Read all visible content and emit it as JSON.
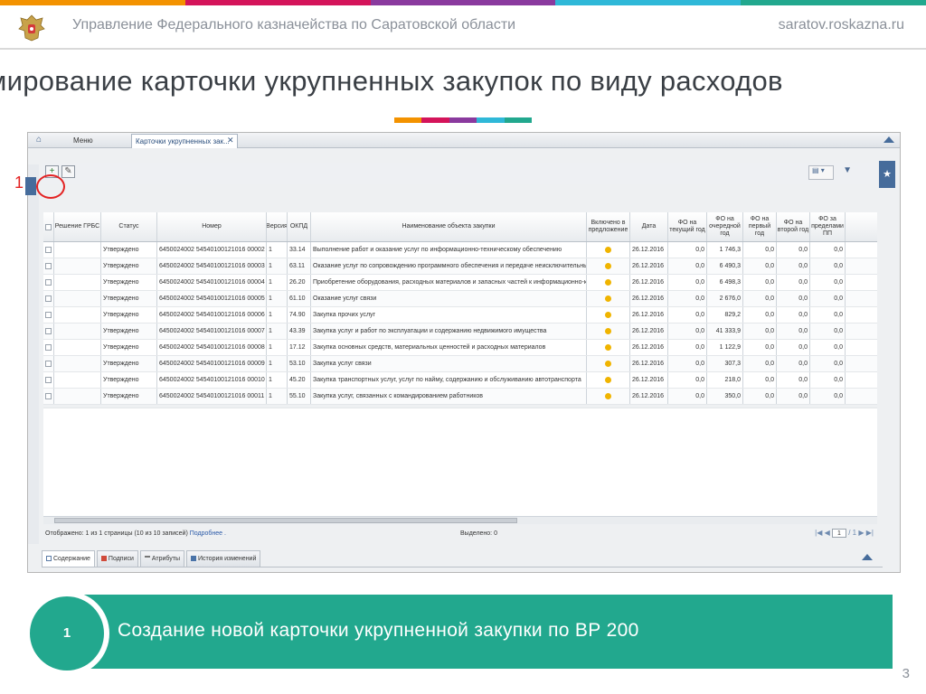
{
  "colors": {
    "orange": "#f39200",
    "magenta": "#d4145a",
    "purple": "#8a3a9e",
    "cyan": "#2fb8d8",
    "teal": "#22a88e",
    "annotation_red": "#e32222",
    "app_blue": "#466c9b"
  },
  "header": {
    "emblem_icon": "double-headed-eagle-emblem",
    "title": "Управление Федерального казначейства по Саратовской области",
    "site": "saratov.roskazna.ru"
  },
  "slide": {
    "title": "мирование карточки укрупненных закупок по виду расходов",
    "page_number": "3"
  },
  "app": {
    "tabs": {
      "home_icon": "home-icon",
      "menu": "Меню",
      "active_tab": "Карточки укрупненных зак...",
      "close_icon": "close-icon"
    },
    "toolbar": {
      "add_icon": "add-icon",
      "edit_icon": "edit-icon",
      "settings_icon": "grid-settings-icon",
      "filter_icon": "filter-icon"
    },
    "grid": {
      "headers": {
        "reshenie": "Решение ГРБС",
        "status": "Статус",
        "number": "Номер",
        "version": "Версия",
        "okpd": "ОКПД",
        "name": "Наименование объекта закупки",
        "included": "Включено в предложение",
        "date": "Дата",
        "fo_current": "ФО на текущий год",
        "fo_next": "ФО на очередной год",
        "fo_first": "ФО на первый год",
        "fo_second": "ФО на второй год",
        "fo_pp": "ФО за пределами ПП"
      },
      "rows": [
        {
          "status": "Утверждено",
          "number": "6450024002 54540100121016 00002",
          "version": "1",
          "okpd": "33.14",
          "name": "Выполнение работ и оказание услуг по информационно-техническому обеспечению",
          "date": "26.12.2016",
          "fo_current": "0,0",
          "fo_next": "1 746,3",
          "fo_first": "0,0",
          "fo_second": "0,0",
          "fo_pp": "0,0"
        },
        {
          "status": "Утверждено",
          "number": "6450024002 54540100121016 00003",
          "version": "1",
          "okpd": "63.11",
          "name": "Оказание услуг по сопровождению программного обеспечения и передаче неисключительных прав на ис",
          "date": "26.12.2016",
          "fo_current": "0,0",
          "fo_next": "6 490,3",
          "fo_first": "0,0",
          "fo_second": "0,0",
          "fo_pp": "0,0"
        },
        {
          "status": "Утверждено",
          "number": "6450024002 54540100121016 00004",
          "version": "1",
          "okpd": "26.20",
          "name": "Приобретение оборудования, расходных материалов и запасных частей к информационно-коммуни",
          "date": "26.12.2016",
          "fo_current": "0,0",
          "fo_next": "6 498,3",
          "fo_first": "0,0",
          "fo_second": "0,0",
          "fo_pp": "0,0"
        },
        {
          "status": "Утверждено",
          "number": "6450024002 54540100121016 00005",
          "version": "1",
          "okpd": "61.10",
          "name": "Оказание услуг связи",
          "date": "26.12.2016",
          "fo_current": "0,0",
          "fo_next": "2 676,0",
          "fo_first": "0,0",
          "fo_second": "0,0",
          "fo_pp": "0,0"
        },
        {
          "status": "Утверждено",
          "number": "6450024002 54540100121016 00006",
          "version": "1",
          "okpd": "74.90",
          "name": "Закупка прочих услуг",
          "date": "26.12.2016",
          "fo_current": "0,0",
          "fo_next": "829,2",
          "fo_first": "0,0",
          "fo_second": "0,0",
          "fo_pp": "0,0"
        },
        {
          "status": "Утверждено",
          "number": "6450024002 54540100121016 00007",
          "version": "1",
          "okpd": "43.39",
          "name": "Закупка услуг и работ по эксплуатации и содержанию недвижимого имущества",
          "date": "26.12.2016",
          "fo_current": "0,0",
          "fo_next": "41 333,9",
          "fo_first": "0,0",
          "fo_second": "0,0",
          "fo_pp": "0,0"
        },
        {
          "status": "Утверждено",
          "number": "6450024002 54540100121016 00008",
          "version": "1",
          "okpd": "17.12",
          "name": "Закупка основных средств, материальных ценностей и расходных материалов",
          "date": "26.12.2016",
          "fo_current": "0,0",
          "fo_next": "1 122,9",
          "fo_first": "0,0",
          "fo_second": "0,0",
          "fo_pp": "0,0"
        },
        {
          "status": "Утверждено",
          "number": "6450024002 54540100121016 00009",
          "version": "1",
          "okpd": "53.10",
          "name": "Закупка услуг связи",
          "date": "26.12.2016",
          "fo_current": "0,0",
          "fo_next": "307,3",
          "fo_first": "0,0",
          "fo_second": "0,0",
          "fo_pp": "0,0"
        },
        {
          "status": "Утверждено",
          "number": "6450024002 54540100121016 00010",
          "version": "1",
          "okpd": "45.20",
          "name": "Закупка транспортных услуг, услуг по найму, содержанию и обслуживанию автотранспорта",
          "date": "26.12.2016",
          "fo_current": "0,0",
          "fo_next": "218,0",
          "fo_first": "0,0",
          "fo_second": "0,0",
          "fo_pp": "0,0"
        },
        {
          "status": "Утверждено",
          "number": "6450024002 54540100121016 00011",
          "version": "1",
          "okpd": "55.10",
          "name": "Закупка услуг, связанных с командированием работников",
          "date": "26.12.2016",
          "fo_current": "0,0",
          "fo_next": "350,0",
          "fo_first": "0,0",
          "fo_second": "0,0",
          "fo_pp": "0,0"
        }
      ]
    },
    "status": {
      "shown": "Отображено: 1 из 1 страницы (10 из 10 записей)",
      "more_link": "Подробнее .",
      "selected": "Выделено: 0",
      "pager_first": "|◀",
      "pager_prev": "◀",
      "page_value": "1",
      "page_of": "/ 1",
      "pager_next": "▶",
      "pager_last": "▶|"
    },
    "bottom_tabs": [
      {
        "label": "Содержание",
        "icon": "content-icon"
      },
      {
        "label": "Подписи",
        "icon": "signature-icon"
      },
      {
        "label": "Атрибуты",
        "icon": "attributes-icon"
      },
      {
        "label": "История изменений",
        "icon": "history-icon"
      }
    ]
  },
  "annotation": {
    "label": "1"
  },
  "callout": {
    "number": "1",
    "text": "Создание новой карточки укрупненной закупки по ВР 200"
  }
}
